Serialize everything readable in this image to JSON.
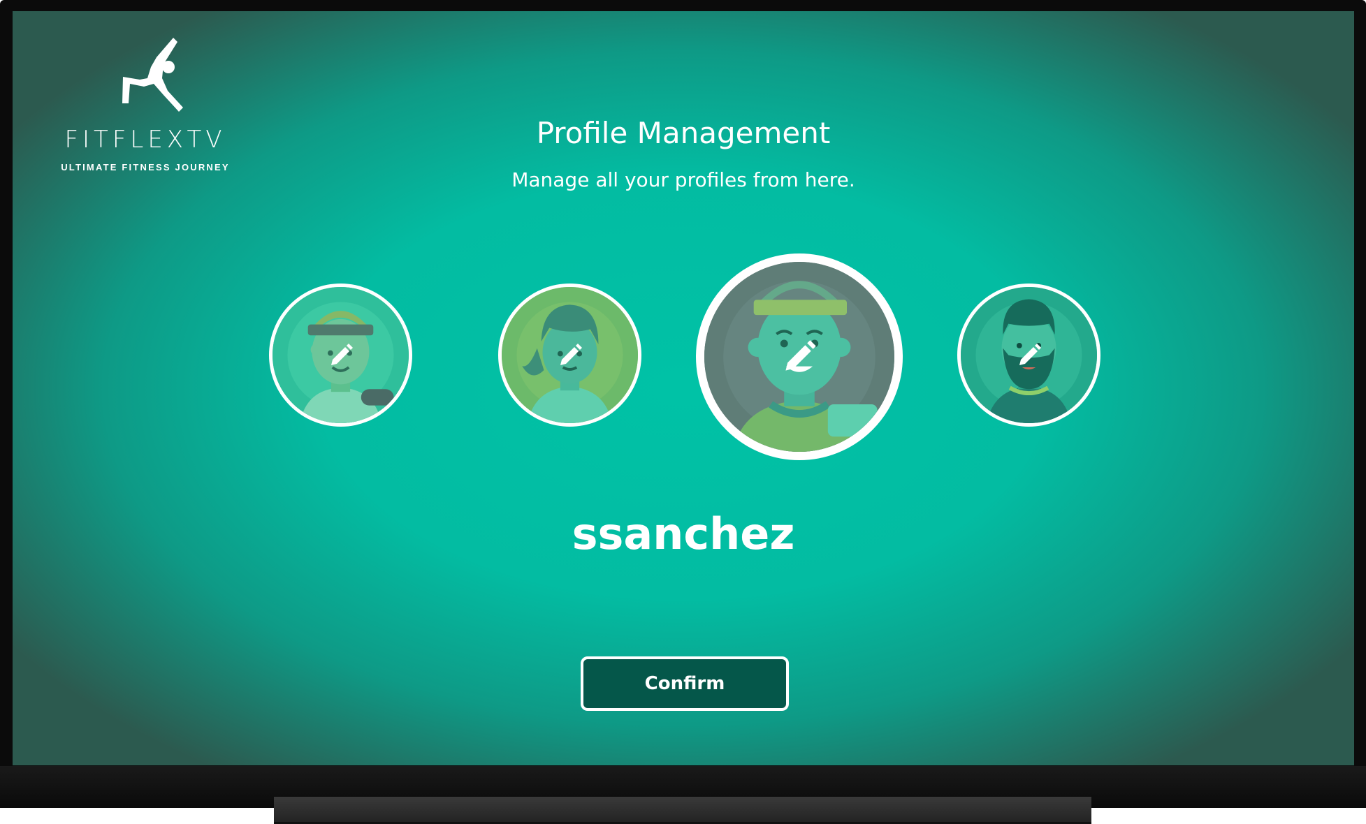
{
  "app": {
    "brand_name": "FITFLEXTV",
    "brand_tagline": "ULTIMATE FITNESS JOURNEY",
    "logo_icon": "yoga-pose-figure-icon"
  },
  "header": {
    "title": "Profile Management",
    "subtitle": "Manage all your profiles from here."
  },
  "profiles": [
    {
      "avatar": "woman-headband-dumbbell",
      "edit_icon": "pencil-icon",
      "selected": false
    },
    {
      "avatar": "woman-ponytail",
      "edit_icon": "pencil-icon",
      "selected": false
    },
    {
      "avatar": "man-headband-dumbbell",
      "edit_icon": "pencil-icon",
      "selected": true
    },
    {
      "avatar": "man-beard",
      "edit_icon": "pencil-icon",
      "selected": false
    }
  ],
  "selected_profile": {
    "username": "ssanchez"
  },
  "actions": {
    "confirm_label": "Confirm"
  },
  "colors": {
    "screen_center": "#00c2a6",
    "screen_edge": "#2c5a4f",
    "button_bg": "#05574a",
    "text": "#ffffff"
  }
}
